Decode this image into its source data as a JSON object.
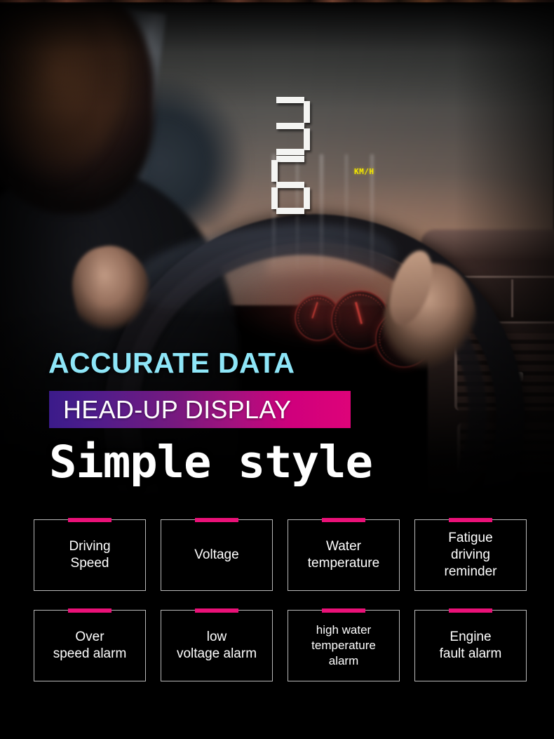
{
  "hud": {
    "speed": "36",
    "unit": "KM/H",
    "unit_color": "#f2e500"
  },
  "headline": {
    "line1": "ACCURATE DATA",
    "line1_color": "#8ee6f8",
    "line2": "HEAD-UP DISPLAY",
    "line2_bar_gradient_from": "#3b1b8a",
    "line2_bar_gradient_to": "#de0379",
    "line3": "Simple style"
  },
  "features": {
    "accent_color": "#ea1178",
    "border_color": "#b9b9b9",
    "row1": [
      {
        "label": "Driving\nSpeed"
      },
      {
        "label": "Voltage"
      },
      {
        "label": "Water\ntemperature"
      },
      {
        "label": "Fatigue\ndriving\nreminder"
      }
    ],
    "row2": [
      {
        "label": "Over\nspeed alarm"
      },
      {
        "label": "low\nvoltage alarm"
      },
      {
        "label": "high water\ntemperature\nalarm"
      },
      {
        "label": "Engine\nfault alarm"
      }
    ]
  }
}
